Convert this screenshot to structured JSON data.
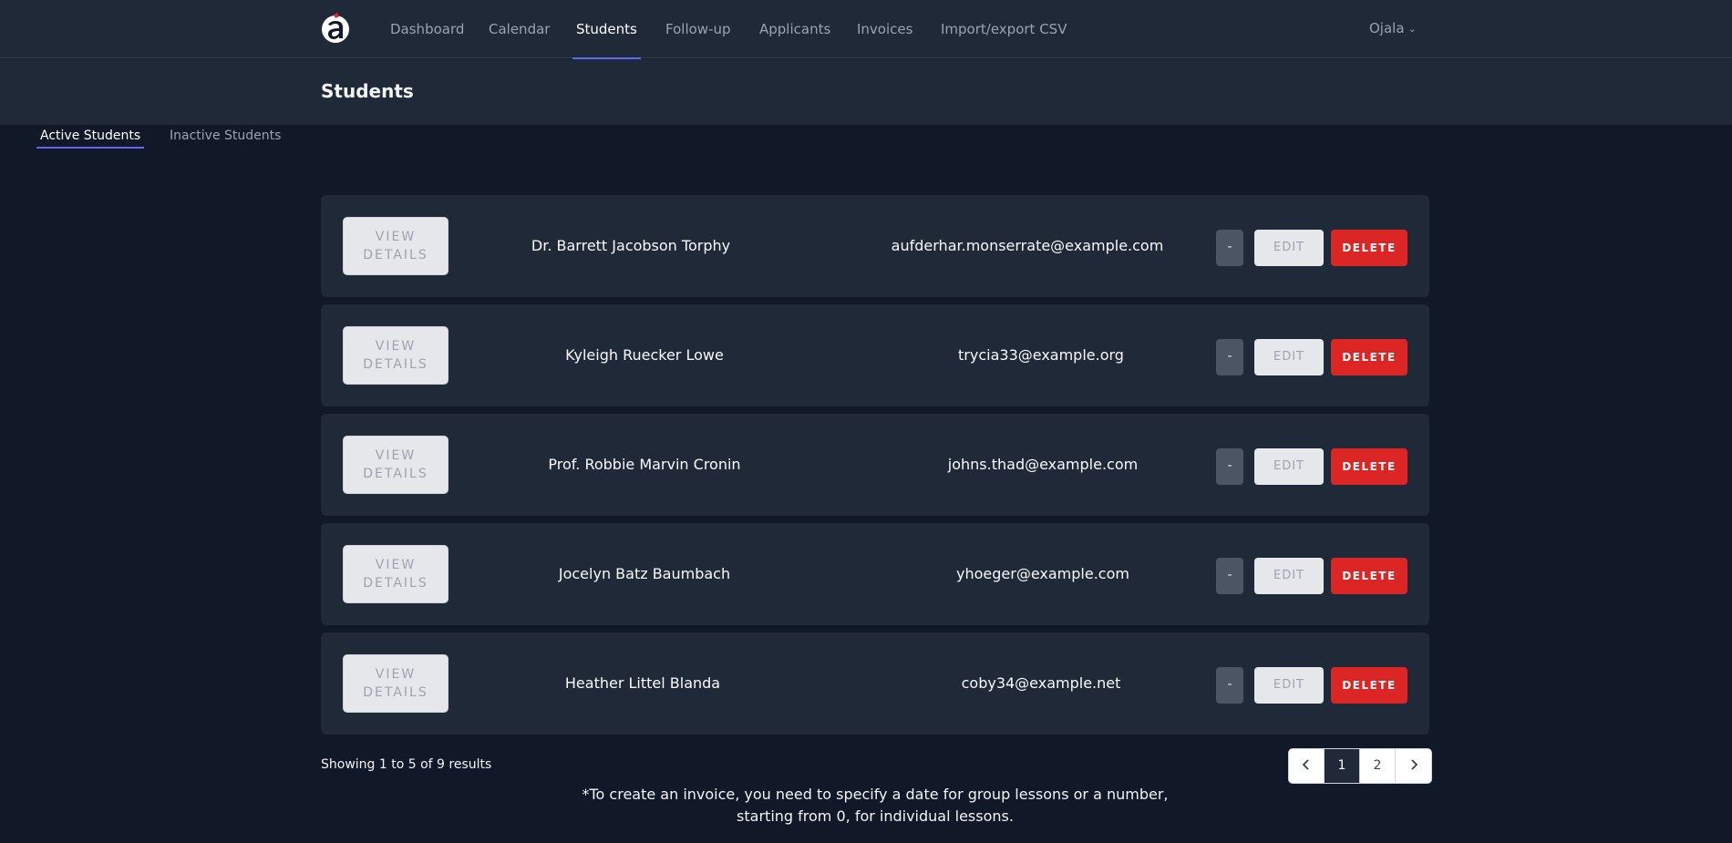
{
  "nav": {
    "items": [
      {
        "label": "Dashboard"
      },
      {
        "label": "Calendar"
      },
      {
        "label": "Students"
      },
      {
        "label": "Follow-up"
      },
      {
        "label": "Applicants"
      },
      {
        "label": "Invoices"
      },
      {
        "label": "Import/export CSV"
      }
    ],
    "active": "Students",
    "user": "Ojala"
  },
  "page": {
    "title": "Students"
  },
  "tabs": [
    {
      "label": "Active Students",
      "active": true
    },
    {
      "label": "Inactive Students",
      "active": false
    }
  ],
  "labels": {
    "view_line1": "VIEW",
    "view_line2": "DETAILS",
    "dash": "-",
    "edit": "EDIT",
    "delete": "DELETE"
  },
  "students": [
    {
      "name": "Dr. Barrett Jacobson Torphy",
      "email": "aufderhar.monserrate@example.com"
    },
    {
      "name": "Kyleigh Ruecker Lowe",
      "email": "trycia33@example.org"
    },
    {
      "name": "Prof. Robbie Marvin Cronin",
      "email": "johns.thad@example.com"
    },
    {
      "name": "Jocelyn Batz Baumbach",
      "email": "yhoeger@example.com"
    },
    {
      "name": "Heather Littel Blanda",
      "email": "coby34@example.net"
    }
  ],
  "footer": {
    "showing": "Showing 1 to 5 of 9 results",
    "pages": [
      "1",
      "2"
    ],
    "current_page": "1",
    "note_line1": "*To create an invoice, you need to specify a date for group lessons or a number,",
    "note_line2": "starting from 0, for individual lessons."
  },
  "colors": {
    "background": "#111827",
    "panel": "#1f2937",
    "accent": "#6366f1",
    "danger": "#dc2626"
  }
}
